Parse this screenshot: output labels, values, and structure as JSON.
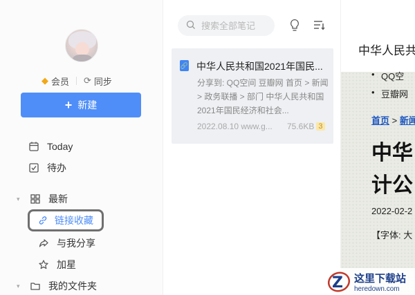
{
  "sidebar": {
    "member_label": "会员",
    "sync_label": "同步",
    "new_button_label": "新建",
    "items": [
      {
        "label": "Today"
      },
      {
        "label": "待办"
      },
      {
        "label": "最新"
      },
      {
        "label": "链接收藏"
      },
      {
        "label": "与我分享"
      },
      {
        "label": "加星"
      },
      {
        "label": "我的文件夹"
      }
    ]
  },
  "list": {
    "search_placeholder": "搜索全部笔记",
    "note": {
      "title": "中华人民共和国2021年国民...",
      "snippet": "分享到: QQ空间 豆瓣网 首页 > 新闻 > 政务联播 > 部门 中华人民共和国2021年国民经济和社会...",
      "date": "2022.08.10 www.g...",
      "size": "75.6KB",
      "badge": "3"
    }
  },
  "preview": {
    "title": "中华人民共",
    "bullet_1": "QQ空",
    "bullet_2": "豆瓣网",
    "crumb_home": "首页",
    "crumb_sep": " > ",
    "crumb_next": "新闻",
    "big_line_1": "中华",
    "big_line_2": "计公",
    "date": "2022-02-2",
    "font_line": "【字体: 大"
  },
  "watermark": {
    "main": "这里下载站",
    "sub": "heredown.com"
  }
}
